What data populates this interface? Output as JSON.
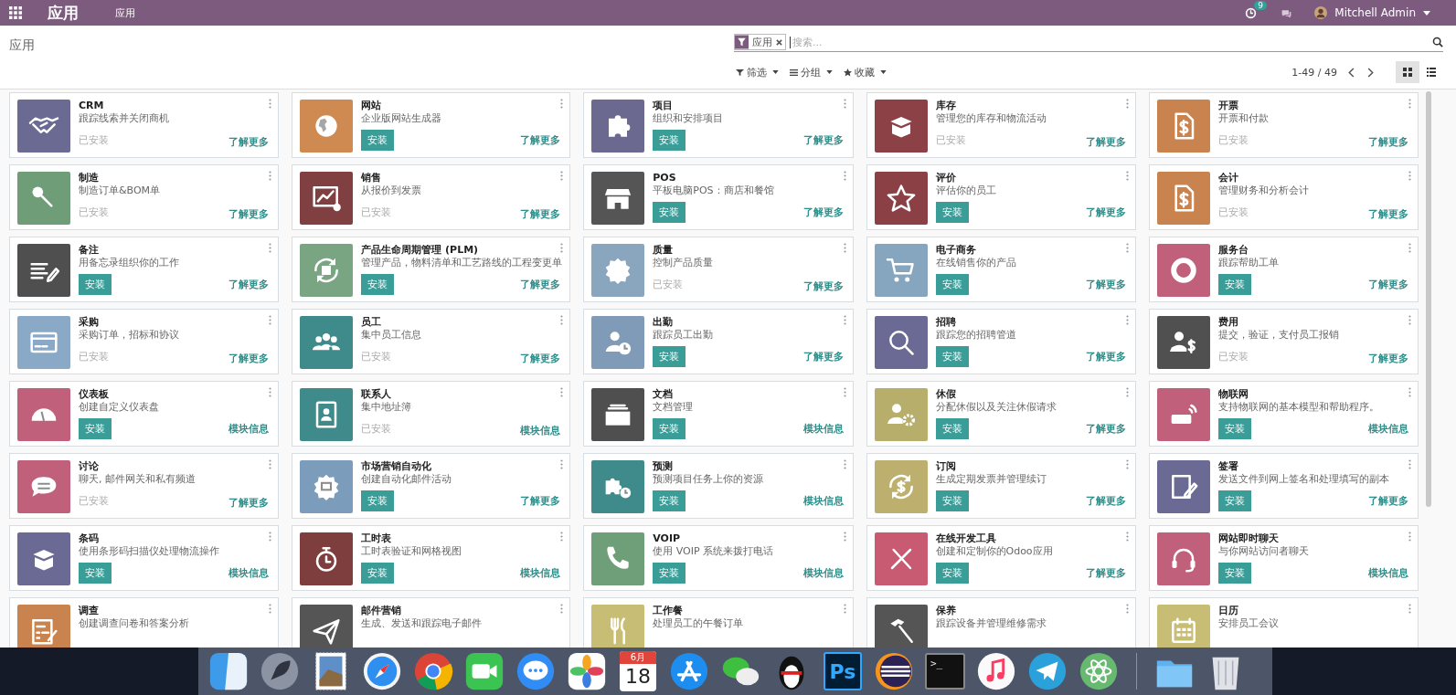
{
  "navbar": {
    "brand": "应用",
    "menu_items": [
      "应用"
    ],
    "activity_badge": "9",
    "user": "Mitchell Admin"
  },
  "control_panel": {
    "breadcrumb": "应用",
    "search": {
      "facet": "应用",
      "placeholder": "搜索..."
    },
    "dropdowns": [
      "筛选",
      "分组",
      "收藏"
    ],
    "pager": "1-49 / 49",
    "views": [
      {
        "kind": "kanban",
        "selected": true
      },
      {
        "kind": "list",
        "selected": false
      }
    ]
  },
  "apps": [
    {
      "name": "CRM",
      "summary": "跟踪线索并关闭商机",
      "color": "#6a6a92",
      "installed": true,
      "status": "已安装",
      "link": "了解更多"
    },
    {
      "name": "网站",
      "summary": "企业版网站生成器",
      "color": "#cf8a52",
      "installed": false,
      "status": "安装",
      "link": "了解更多"
    },
    {
      "name": "项目",
      "summary": "组织和安排项目",
      "color": "#6b6990",
      "installed": false,
      "status": "安装",
      "link": "了解更多"
    },
    {
      "name": "库存",
      "summary": "管理您的库存和物流活动",
      "color": "#8c4147",
      "installed": true,
      "status": "已安装",
      "link": "了解更多"
    },
    {
      "name": "开票",
      "summary": "开票和付款",
      "color": "#c9834f",
      "installed": true,
      "status": "已安装",
      "link": "了解更多"
    },
    {
      "name": "制造",
      "summary": "制造订单&BOM单",
      "color": "#6e9d78",
      "installed": true,
      "status": "已安装",
      "link": "了解更多"
    },
    {
      "name": "销售",
      "summary": "从报价到发票",
      "color": "#803f40",
      "installed": true,
      "status": "已安装",
      "link": "了解更多"
    },
    {
      "name": "POS",
      "summary": "平板电脑POS：商店和餐馆",
      "color": "#555555",
      "installed": false,
      "status": "安装",
      "link": "了解更多"
    },
    {
      "name": "评价",
      "summary": "评估你的员工",
      "color": "#8b4046",
      "installed": false,
      "status": "安装",
      "link": "了解更多"
    },
    {
      "name": "会计",
      "summary": "管理财务和分析会计",
      "color": "#c9834f",
      "installed": true,
      "status": "已安装",
      "link": "了解更多"
    },
    {
      "name": "备注",
      "summary": "用备忘录组织你的工作",
      "color": "#4f4f4f",
      "installed": false,
      "status": "安装",
      "link": "了解更多"
    },
    {
      "name": "产品生命周期管理 (PLM)",
      "summary": "管理产品，物料清单和工艺路线的工程变更单",
      "color": "#7aa582",
      "installed": false,
      "status": "安装",
      "link": "了解更多"
    },
    {
      "name": "质量",
      "summary": "控制产品质量",
      "color": "#8aa6bf",
      "installed": true,
      "status": "已安装",
      "link": "了解更多"
    },
    {
      "name": "电子商务",
      "summary": "在线销售你的产品",
      "color": "#86a6c0",
      "installed": false,
      "status": "安装",
      "link": "了解更多"
    },
    {
      "name": "服务台",
      "summary": "跟踪帮助工单",
      "color": "#c0607a",
      "installed": false,
      "status": "安装",
      "link": "了解更多"
    },
    {
      "name": "采购",
      "summary": "采购订单，招标和协议",
      "color": "#89a9c6",
      "installed": true,
      "status": "已安装",
      "link": "了解更多"
    },
    {
      "name": "员工",
      "summary": "集中员工信息",
      "color": "#3f8a8a",
      "installed": true,
      "status": "已安装",
      "link": "了解更多"
    },
    {
      "name": "出勤",
      "summary": "跟踪员工出勤",
      "color": "#7f9bb8",
      "installed": false,
      "status": "安装",
      "link": "了解更多"
    },
    {
      "name": "招聘",
      "summary": "跟踪您的招聘管道",
      "color": "#6b6a95",
      "installed": false,
      "status": "安装",
      "link": "了解更多"
    },
    {
      "name": "费用",
      "summary": "提交，验证，支付员工报销",
      "color": "#505050",
      "installed": true,
      "status": "已安装",
      "link": "了解更多"
    },
    {
      "name": "仪表板",
      "summary": "创建自定义仪表盘",
      "color": "#c0607a",
      "installed": false,
      "status": "安装",
      "link": "模块信息"
    },
    {
      "name": "联系人",
      "summary": "集中地址簿",
      "color": "#3f8a8a",
      "installed": true,
      "status": "已安装",
      "link": "模块信息"
    },
    {
      "name": "文档",
      "summary": "文档管理",
      "color": "#4f4f4f",
      "installed": false,
      "status": "安装",
      "link": "模块信息"
    },
    {
      "name": "休假",
      "summary": "分配休假以及关注休假请求",
      "color": "#b8ae6c",
      "installed": false,
      "status": "安装",
      "link": "了解更多"
    },
    {
      "name": "物联网",
      "summary": "支持物联网的基本模型和帮助程序。",
      "color": "#c0607a",
      "installed": false,
      "status": "安装",
      "link": "模块信息"
    },
    {
      "name": "讨论",
      "summary": "聊天, 邮件网关和私有频道",
      "color": "#c0607a",
      "installed": true,
      "status": "已安装",
      "link": "了解更多"
    },
    {
      "name": "市场营销自动化",
      "summary": "创建自动化邮件活动",
      "color": "#7c9cbc",
      "installed": false,
      "status": "安装",
      "link": "了解更多"
    },
    {
      "name": "预测",
      "summary": "预测项目任务上你的资源",
      "color": "#3f8a8a",
      "installed": false,
      "status": "安装",
      "link": "模块信息"
    },
    {
      "name": "订阅",
      "summary": "生成定期发票并管理续订",
      "color": "#bdb06f",
      "installed": false,
      "status": "安装",
      "link": "了解更多"
    },
    {
      "name": "签署",
      "summary": "发送文件到网上签名和处理填写的副本",
      "color": "#6b6a95",
      "installed": false,
      "status": "安装",
      "link": "了解更多"
    },
    {
      "name": "条码",
      "summary": "使用条形码扫描仪处理物流操作",
      "color": "#6b6a95",
      "installed": false,
      "status": "安装",
      "link": "模块信息"
    },
    {
      "name": "工时表",
      "summary": "工时表验证和网格视图",
      "color": "#7e3e3e",
      "installed": false,
      "status": "安装",
      "link": "模块信息"
    },
    {
      "name": "VOIP",
      "summary": "使用 VOIP 系统来拨打电话",
      "color": "#6f9f79",
      "installed": false,
      "status": "安装",
      "link": "模块信息"
    },
    {
      "name": "在线开发工具",
      "summary": "创建和定制你的Odoo应用",
      "color": "#c85a72",
      "installed": false,
      "status": "安装",
      "link": "了解更多"
    },
    {
      "name": "网站即时聊天",
      "summary": "与你网站访问者聊天",
      "color": "#c0607a",
      "installed": false,
      "status": "安装",
      "link": "模块信息"
    },
    {
      "name": "调查",
      "summary": "创建调查问卷和答案分析",
      "color": "#c9834f"
    },
    {
      "name": "邮件营销",
      "summary": "生成、发送和跟踪电子邮件",
      "color": "#555555"
    },
    {
      "name": "工作餐",
      "summary": "处理员工的午餐订单",
      "color": "#c8bd74"
    },
    {
      "name": "保养",
      "summary": "跟踪设备并管理维修需求",
      "color": "#555555"
    },
    {
      "name": "日历",
      "summary": "安排员工会议",
      "color": "#c8bd74"
    }
  ],
  "dock": {
    "items": [
      {
        "kind": "finder"
      },
      {
        "kind": "rocket"
      },
      {
        "kind": "stamp"
      },
      {
        "kind": "compass"
      },
      {
        "kind": "ring"
      },
      {
        "kind": "video"
      },
      {
        "kind": "bubble"
      },
      {
        "kind": "flower"
      },
      {
        "kind": "calendar",
        "month": "6月",
        "day": "18"
      },
      {
        "kind": "appstore"
      },
      {
        "kind": "bubbles"
      },
      {
        "kind": "penguin"
      },
      {
        "kind": "ps",
        "label": "Ps"
      },
      {
        "kind": "eclipse"
      },
      {
        "kind": "terminal",
        "label": ">_"
      },
      {
        "kind": "music"
      },
      {
        "kind": "plane"
      },
      {
        "kind": "atom"
      },
      {
        "kind": "separator"
      },
      {
        "kind": "folder"
      },
      {
        "kind": "trash"
      }
    ]
  }
}
